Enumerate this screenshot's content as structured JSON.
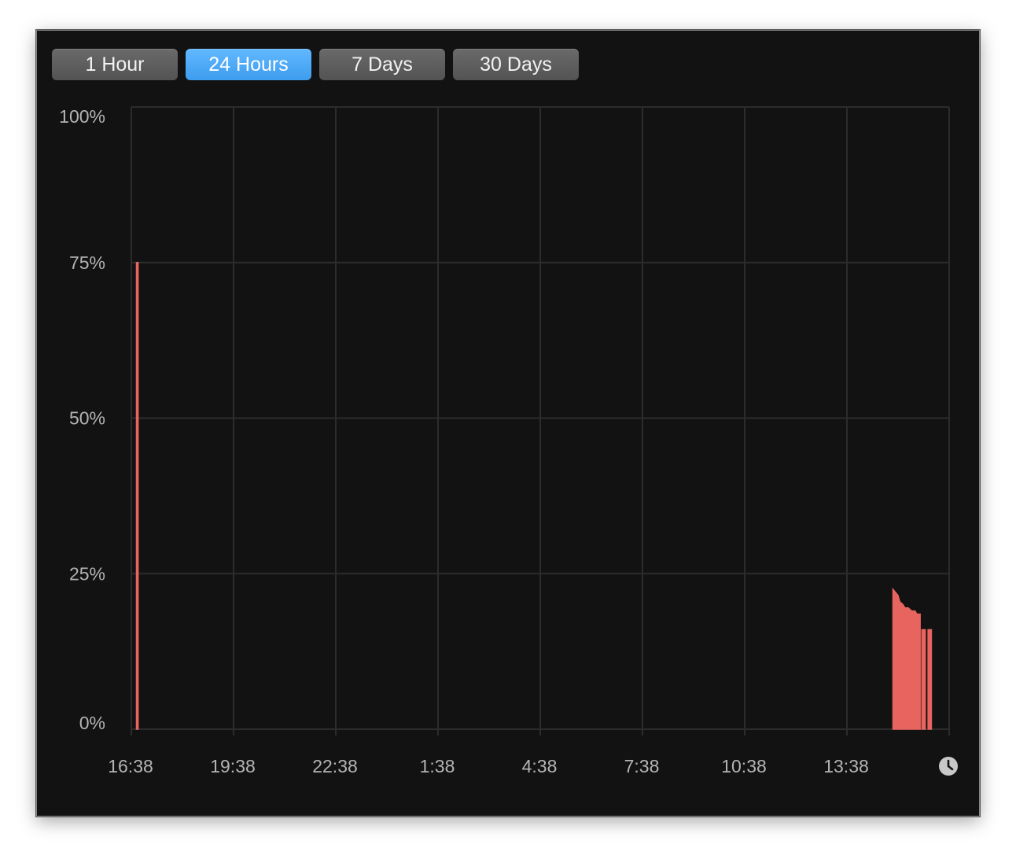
{
  "range_buttons": {
    "hour": "1 Hour",
    "day": "24 Hours",
    "week": "7 Days",
    "month": "30 Days",
    "selected": "24 Hours"
  },
  "colors": {
    "background": "#121212",
    "grid": "#2c2c2c",
    "series": "#e8645f",
    "selected_button": "#4aa8f5",
    "axis_text": "#b4b4b4"
  },
  "icons": {
    "time": "clock-icon"
  },
  "chart_data": {
    "type": "area",
    "xlabel": "",
    "ylabel": "",
    "x_tick_labels": [
      "16:38",
      "19:38",
      "22:38",
      "1:38",
      "4:38",
      "7:38",
      "10:38",
      "13:38"
    ],
    "y_tick_labels": [
      "0%",
      "25%",
      "50%",
      "75%",
      "100%"
    ],
    "xlim_hours": [
      0,
      24
    ],
    "ylim": [
      0,
      100
    ],
    "grid": true,
    "legend": "none",
    "series": [
      {
        "segments": [
          {
            "x": [
              0.15,
              0.2
            ],
            "y": [
              75,
              75
            ]
          },
          {
            "x": [
              22.35,
              22.5,
              22.55,
              22.65,
              22.7,
              22.8,
              22.9,
              22.95,
              23.0,
              23.05,
              23.1,
              23.15
            ],
            "y": [
              22.5,
              21.5,
              20.5,
              20.0,
              19.5,
              19.5,
              19.0,
              19.0,
              19.0,
              18.5,
              18.5,
              18.5
            ]
          },
          {
            "x": [
              23.2,
              23.3
            ],
            "y": [
              16,
              16
            ]
          },
          {
            "x": [
              23.38,
              23.48
            ],
            "y": [
              16,
              16
            ]
          }
        ]
      }
    ]
  }
}
